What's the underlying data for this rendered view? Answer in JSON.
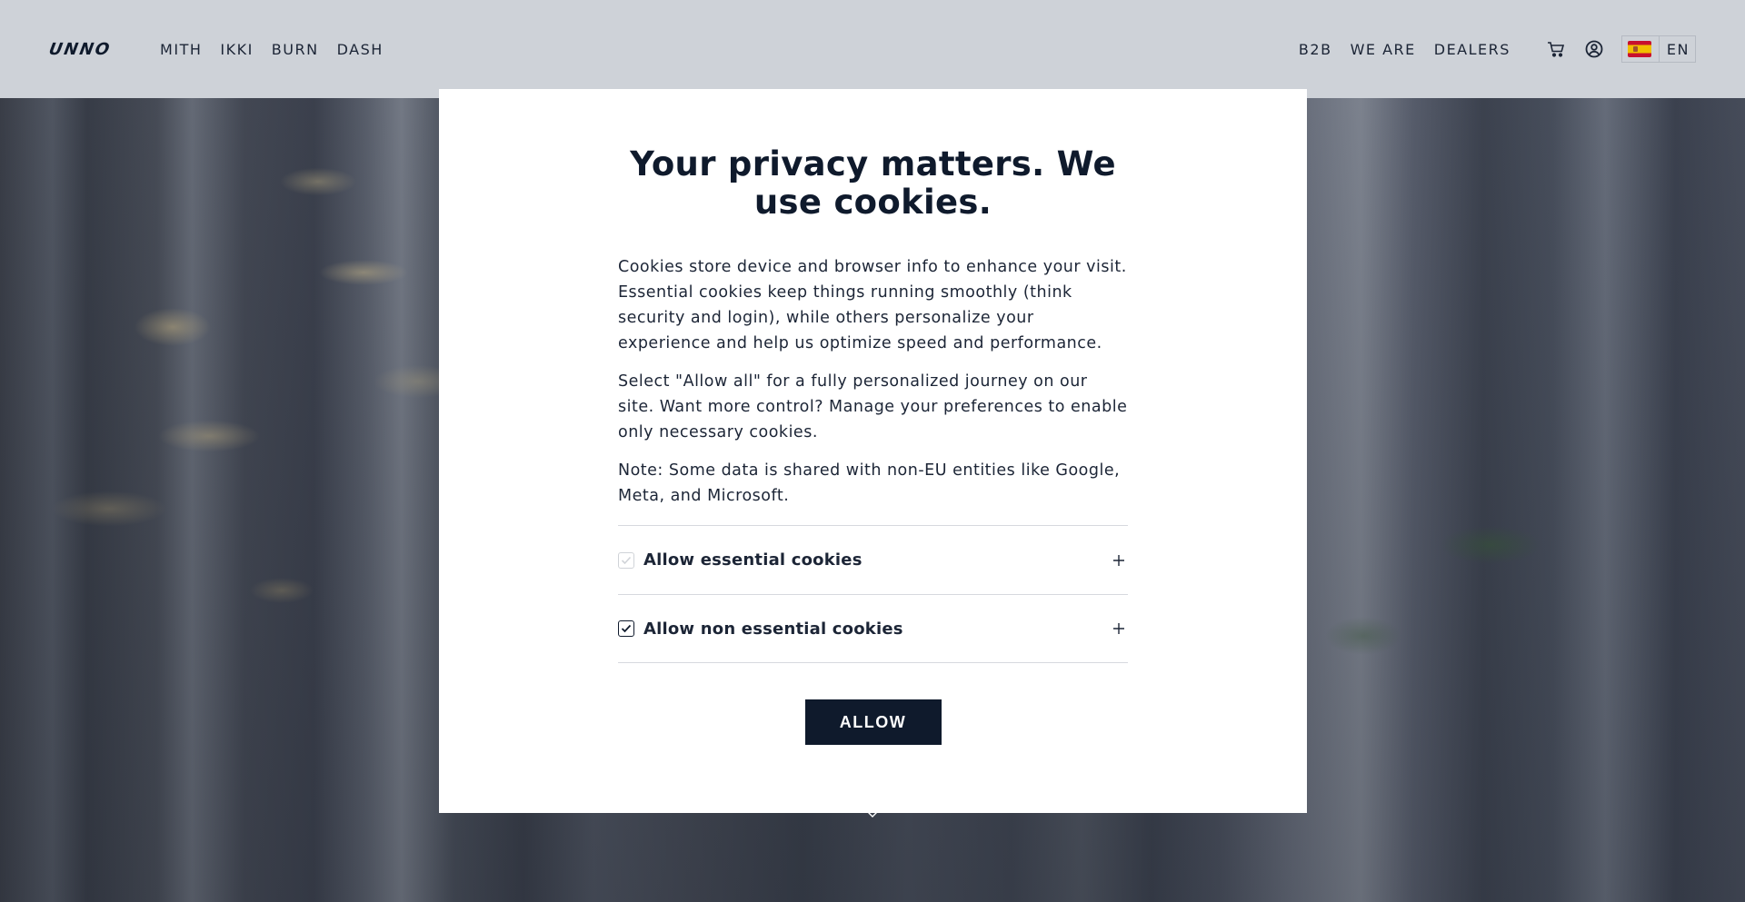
{
  "header": {
    "logo": "UNNO",
    "nav_left": [
      "MITH",
      "IKKI",
      "BURN",
      "DASH"
    ],
    "nav_right": [
      "B2B",
      "WE ARE",
      "DEALERS"
    ],
    "cart_icon": "cart-icon",
    "account_icon": "user-circle-icon",
    "language": {
      "flag": "spain-flag-icon",
      "label": "EN"
    }
  },
  "modal": {
    "title": "Your privacy matters. We use cookies.",
    "paragraphs": [
      "Cookies store device and browser info to enhance your visit. Essential cookies keep things running smoothly (think security and login), while others personalize your experience and help us optimize speed and performance.",
      "Select \"Allow all\" for a fully personalized journey on our site. Want more control? Manage your preferences to enable only necessary cookies.",
      "Note: Some data is shared with non-EU entities like Google, Meta, and Microsoft."
    ],
    "options": [
      {
        "label": "Allow essential cookies",
        "checked": true,
        "disabled": true
      },
      {
        "label": "Allow non essential cookies",
        "checked": true,
        "disabled": false
      }
    ],
    "allow_label": "ALLOW"
  },
  "colors": {
    "header_bg": "#ced2d8",
    "primary": "#0f1a2c",
    "modal_bg": "#ffffff"
  }
}
